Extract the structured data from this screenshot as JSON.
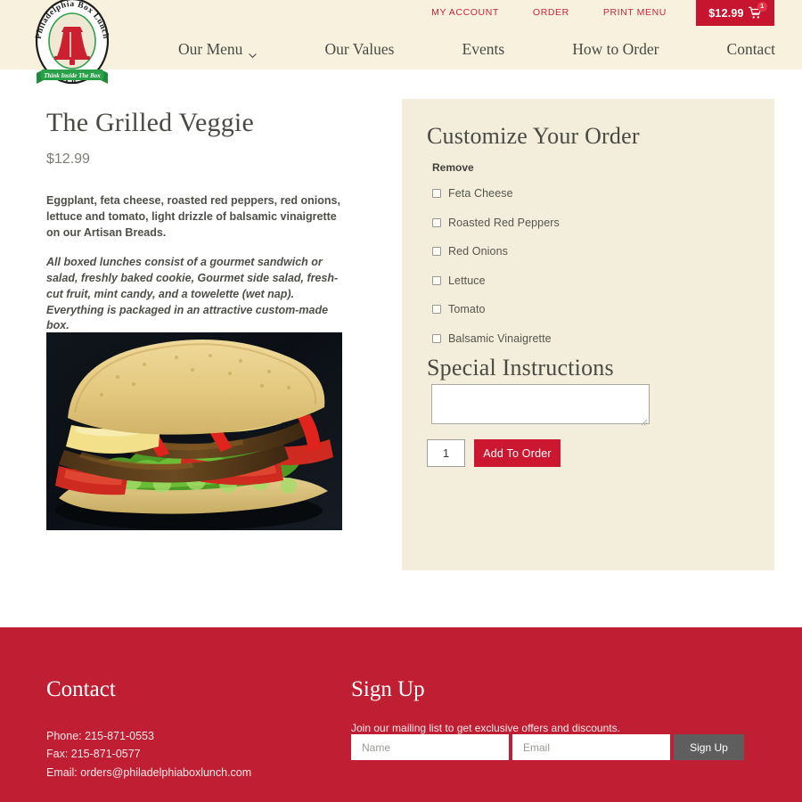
{
  "header": {
    "logo": {
      "ring_text_top": "Philadelphia  Box  Lunch",
      "ring_text_bottom": "Co.",
      "banner_text": "Think Inside The Box",
      "icon": "liberty-bell-icon",
      "colors": {
        "red": "#cc1f2f",
        "green": "#2aa049",
        "cream": "#efe9d4"
      }
    },
    "utility_nav": [
      {
        "label": "MY ACCOUNT",
        "name": "my-account"
      },
      {
        "label": "ORDER",
        "name": "order"
      },
      {
        "label": "PRINT MENU",
        "name": "print-menu"
      }
    ],
    "cart": {
      "amount": "$12.99",
      "badge_count": "1",
      "icon": "shopping-cart-icon"
    },
    "main_nav": [
      {
        "label": "Our Menu",
        "has_dropdown": true,
        "icon": "chevron-down-icon"
      },
      {
        "label": "Our Values",
        "has_dropdown": false
      },
      {
        "label": "Events",
        "has_dropdown": false
      },
      {
        "label": "How to Order",
        "has_dropdown": false
      },
      {
        "label": "Contact",
        "has_dropdown": false
      }
    ]
  },
  "product": {
    "title": "The Grilled Veggie",
    "price": "$12.99",
    "description": "Eggplant, feta cheese, roasted red peppers, red onions, lettuce and tomato, light drizzle of balsamic vinaigrette on our Artisan Breads.",
    "note": " All boxed lunches consist of a gourmet sandwich or salad, freshly baked cookie, Gourmet side salad, fresh-cut fruit, mint candy, and a towelette (wet nap). Everything is packaged in an attractive custom-made box.",
    "image_alt": "grilled-veggie-sandwich-photo"
  },
  "customize": {
    "title": "Customize Your Order",
    "remove_label": "Remove",
    "options": [
      {
        "label": "Feta Cheese",
        "checked": false
      },
      {
        "label": "Roasted Red Peppers",
        "checked": false
      },
      {
        "label": "Red Onions",
        "checked": false
      },
      {
        "label": "Lettuce",
        "checked": false
      },
      {
        "label": "Tomato",
        "checked": false
      },
      {
        "label": "Balsamic Vinaigrette",
        "checked": false
      }
    ],
    "special_instructions": {
      "title": "Special Instructions",
      "value": "",
      "placeholder": ""
    },
    "quantity": "1",
    "add_to_order_label": "Add To Order"
  },
  "footer": {
    "contact": {
      "heading": "Contact",
      "phone": "Phone: 215-871-0553",
      "fax": "Fax: 215-871-0577",
      "email": "Email: orders@philadelphiaboxlunch.com"
    },
    "signup": {
      "heading": "Sign Up",
      "subtitle": "Join our mailing list to get exclusive offers and discounts.",
      "name_placeholder": "Name",
      "name_value": "",
      "email_placeholder": "Email",
      "email_value": "",
      "button_label": "Sign Up"
    }
  },
  "colors": {
    "brand_red": "#c01f33",
    "cart_red": "#c8152f",
    "header_cream": "#f7f1de",
    "panel_cream": "#f2eedb",
    "text_dark": "#4a4a45"
  }
}
